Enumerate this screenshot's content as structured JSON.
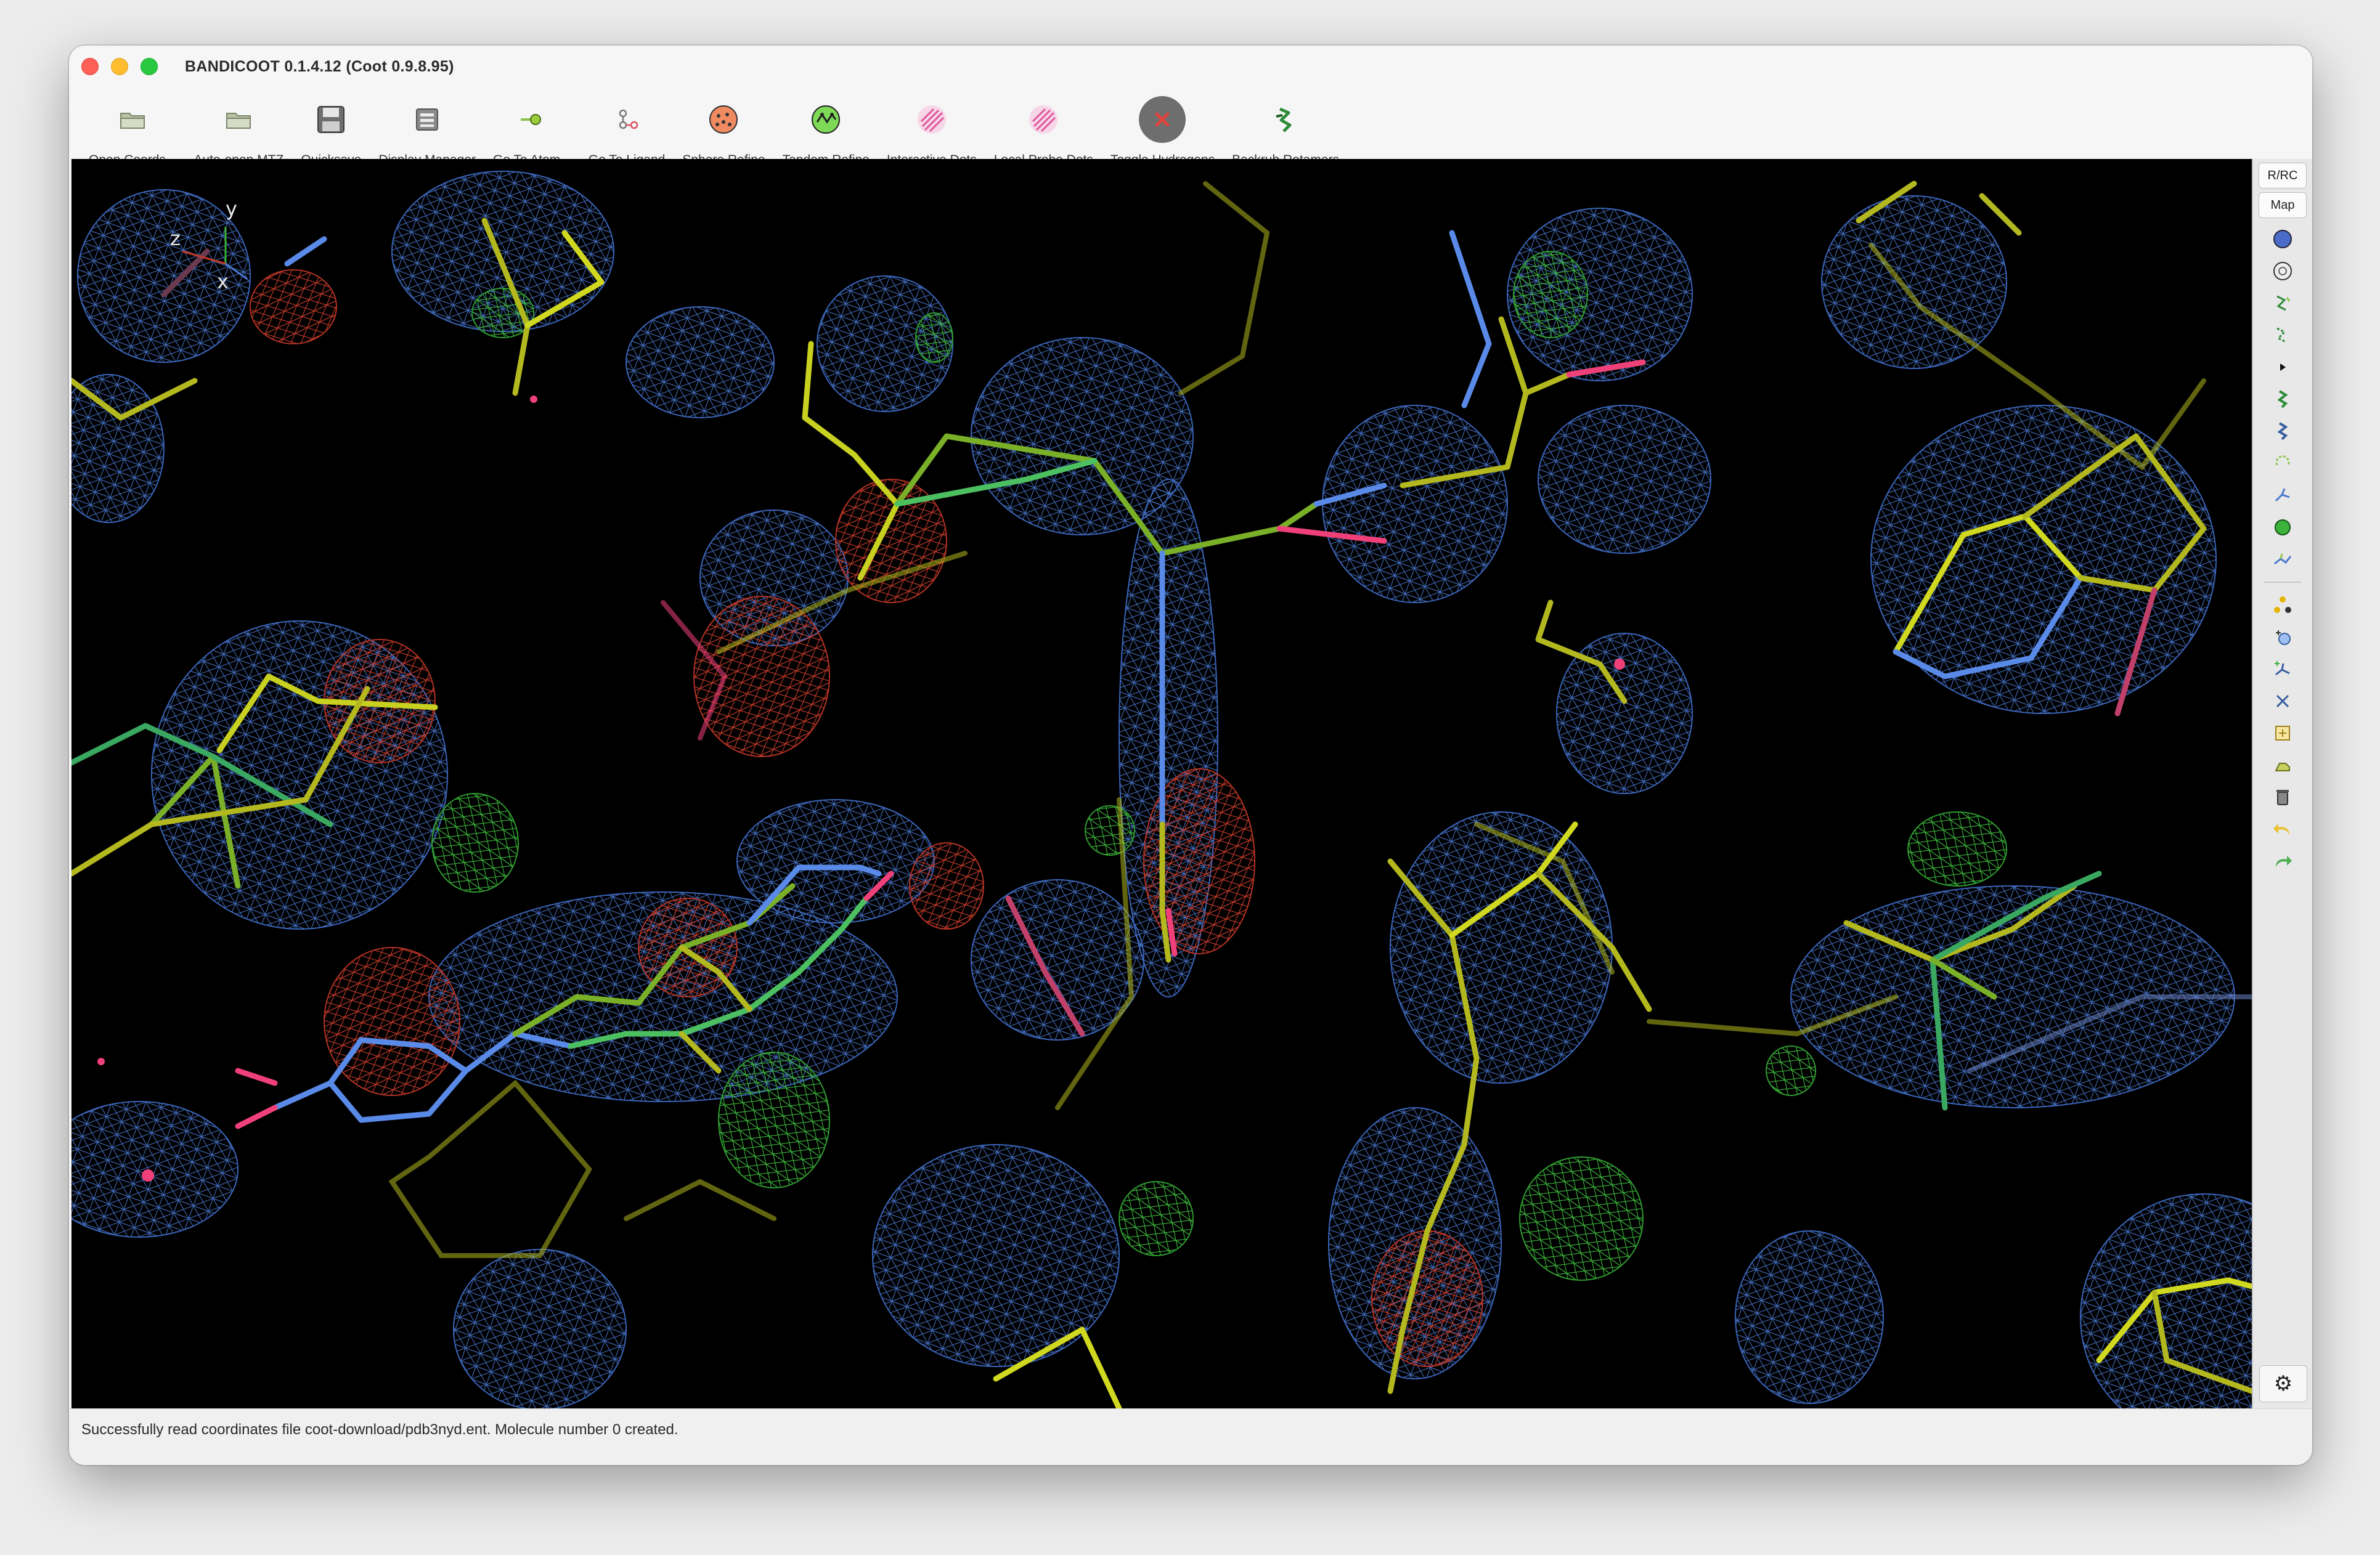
{
  "window": {
    "title": "BANDICOOT 0.1.4.12 (Coot 0.9.8.95)"
  },
  "toolbar": {
    "items": [
      {
        "label": "Open Coords...",
        "icon": "folder-open-icon"
      },
      {
        "label": "Auto-open MTZ",
        "icon": "folder-open-icon"
      },
      {
        "label": "Quicksave",
        "icon": "floppy-disk-icon"
      },
      {
        "label": "Display Manager",
        "icon": "display-manager-icon"
      },
      {
        "label": "Go To Atom...",
        "icon": "go-to-atom-icon"
      },
      {
        "label": "Go To Ligand",
        "icon": "go-to-ligand-icon"
      },
      {
        "label": "Sphere Refine",
        "icon": "sphere-refine-icon"
      },
      {
        "label": "Tandem Refine",
        "icon": "tandem-refine-icon"
      },
      {
        "label": "Interactive Dots",
        "icon": "interactive-dots-icon"
      },
      {
        "label": "Local Probe Dots",
        "icon": "local-probe-dots-icon"
      },
      {
        "label": "Toggle Hydrogens",
        "icon": "toggle-hydrogens-icon"
      },
      {
        "label": "Backrub Rotamers",
        "icon": "backrub-rotamers-icon"
      }
    ]
  },
  "sidebar": {
    "buttons": [
      {
        "label": "R/RC"
      },
      {
        "label": "Map"
      }
    ],
    "icons_group1": [
      "sphere-blue-icon",
      "sphere-outline-icon",
      "chain-flip-icon",
      "chain-dashed-icon",
      "play-triangle-icon",
      "rotamer-icon",
      "rotamer-alt-icon",
      "rotamer-dashed-icon",
      "torsion-icon",
      "green-ball-icon",
      "sidechain-icon"
    ],
    "icons_group2": [
      "triangle-atoms-icon",
      "add-atom-icon",
      "add-terminal-icon",
      "delete-icon",
      "add-water-icon",
      "ligand-icon",
      "trash-icon",
      "undo-icon",
      "redo-icon"
    ],
    "gear_icon": "gear-icon"
  },
  "viewport": {
    "axes": {
      "x": "x",
      "y": "y",
      "z": "z"
    },
    "background": "#000000",
    "mesh_color": "#4a78d0",
    "diff_pos_color": "#3bb33b",
    "diff_neg_color": "#c23a2a",
    "carbon_color": "#b3b81e",
    "nitrogen_color": "#5a8ae8",
    "oxygen_color": "#f0407a"
  },
  "status": {
    "message": "Successfully read coordinates file coot-download/pdb3nyd.ent.  Molecule number 0 created."
  }
}
